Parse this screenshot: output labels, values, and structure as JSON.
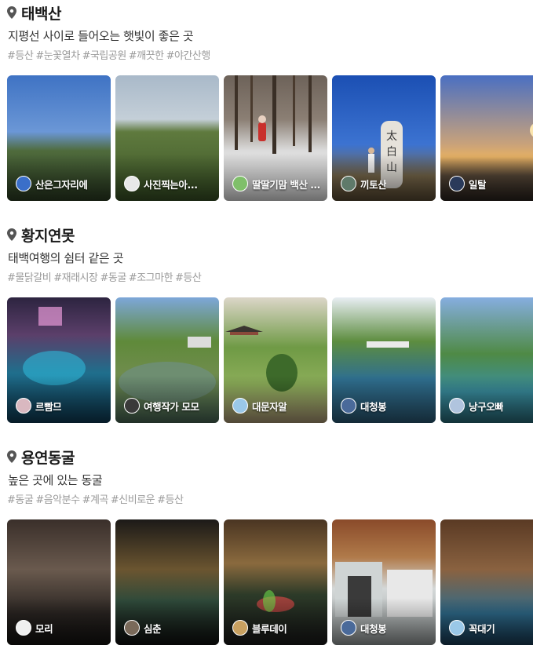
{
  "sections": [
    {
      "title": "태백산",
      "description": "지평선 사이로 들어오는 햇빛이 좋은 곳",
      "tags": [
        "#등산",
        "#눈꽃열차",
        "#국립공원",
        "#깨끗한",
        "#야간산행"
      ],
      "cards": [
        {
          "user": "산은그자리에",
          "avatar": "mountain-avatar"
        },
        {
          "user": "사진찍는아...",
          "avatar": "person-avatar"
        },
        {
          "user": "딸딸기맘",
          "avatar": "flower-avatar",
          "caption": "백산 눈꽃산행!"
        },
        {
          "user": "끼토산",
          "avatar": "hiker-avatar"
        },
        {
          "user": "일탈",
          "avatar": "sky-avatar"
        }
      ]
    },
    {
      "title": "황지연못",
      "description": "태백여행의 쉼터 같은 곳",
      "tags": [
        "#물닭갈비",
        "#재래시장",
        "#동굴",
        "#조그마한",
        "#등산"
      ],
      "cards": [
        {
          "user": "르빰므",
          "avatar": "woman-avatar"
        },
        {
          "user": "여행작가 모모",
          "avatar": "dark-avatar"
        },
        {
          "user": "대문자알",
          "avatar": "light-avatar"
        },
        {
          "user": "대청봉",
          "avatar": "peak-avatar"
        },
        {
          "user": "낭구오빠",
          "avatar": "sky-avatar"
        }
      ]
    },
    {
      "title": "용연동굴",
      "description": "높은 곳에 있는 동굴",
      "tags": [
        "#동굴",
        "#음악분수",
        "#계곡",
        "#신비로운",
        "#등산"
      ],
      "cards": [
        {
          "user": "모리",
          "avatar": "white-avatar"
        },
        {
          "user": "심춘",
          "avatar": "gray-avatar"
        },
        {
          "user": "블루데이",
          "avatar": "yellow-avatar"
        },
        {
          "user": "대청봉",
          "avatar": "peak-avatar"
        },
        {
          "user": "꼭대기",
          "avatar": "sky-avatar"
        }
      ]
    }
  ],
  "icons": {
    "pin": "location-pin-icon"
  },
  "colors": {
    "title": "#1a1a1a",
    "tag": "#9a9a9a",
    "pin": "#555555"
  }
}
